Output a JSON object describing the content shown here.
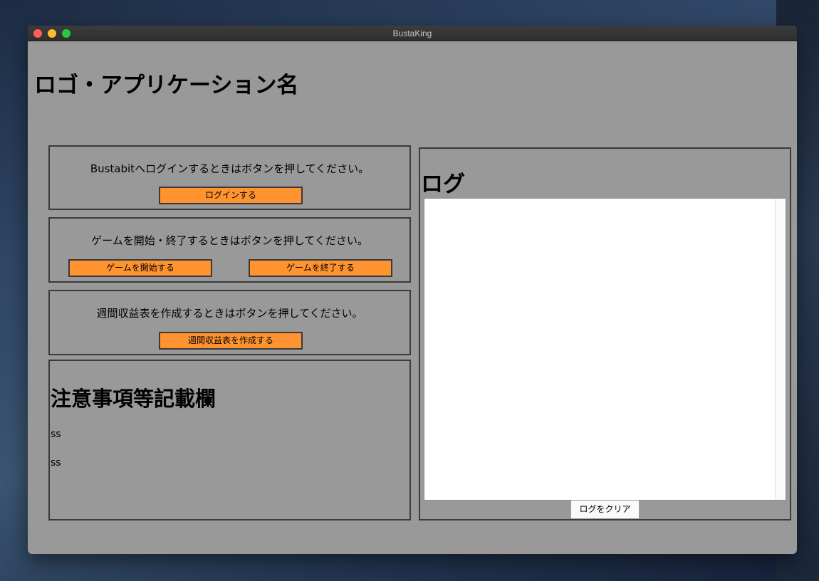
{
  "window": {
    "title": "BustaKing"
  },
  "app": {
    "title": "ロゴ・アプリケーション名"
  },
  "login_panel": {
    "message": "Bustabitへログインするときはボタンを押してください。",
    "button_label": "ログインする"
  },
  "game_panel": {
    "message": "ゲームを開始・終了するときはボタンを押してください。",
    "start_label": "ゲームを開始する",
    "stop_label": "ゲームを終了する"
  },
  "report_panel": {
    "message": "週間収益表を作成するときはボタンを押してください。",
    "button_label": "週間収益表を作成する"
  },
  "notes_panel": {
    "title": "注意事項等記載欄",
    "lines": [
      "ss",
      "ss"
    ]
  },
  "log_panel": {
    "title": "ログ",
    "log_text": "",
    "clear_label": "ログをクリア"
  },
  "colors": {
    "window_bg": "#999999",
    "button_accent": "#ff932f",
    "border": "#3a3a3a"
  }
}
